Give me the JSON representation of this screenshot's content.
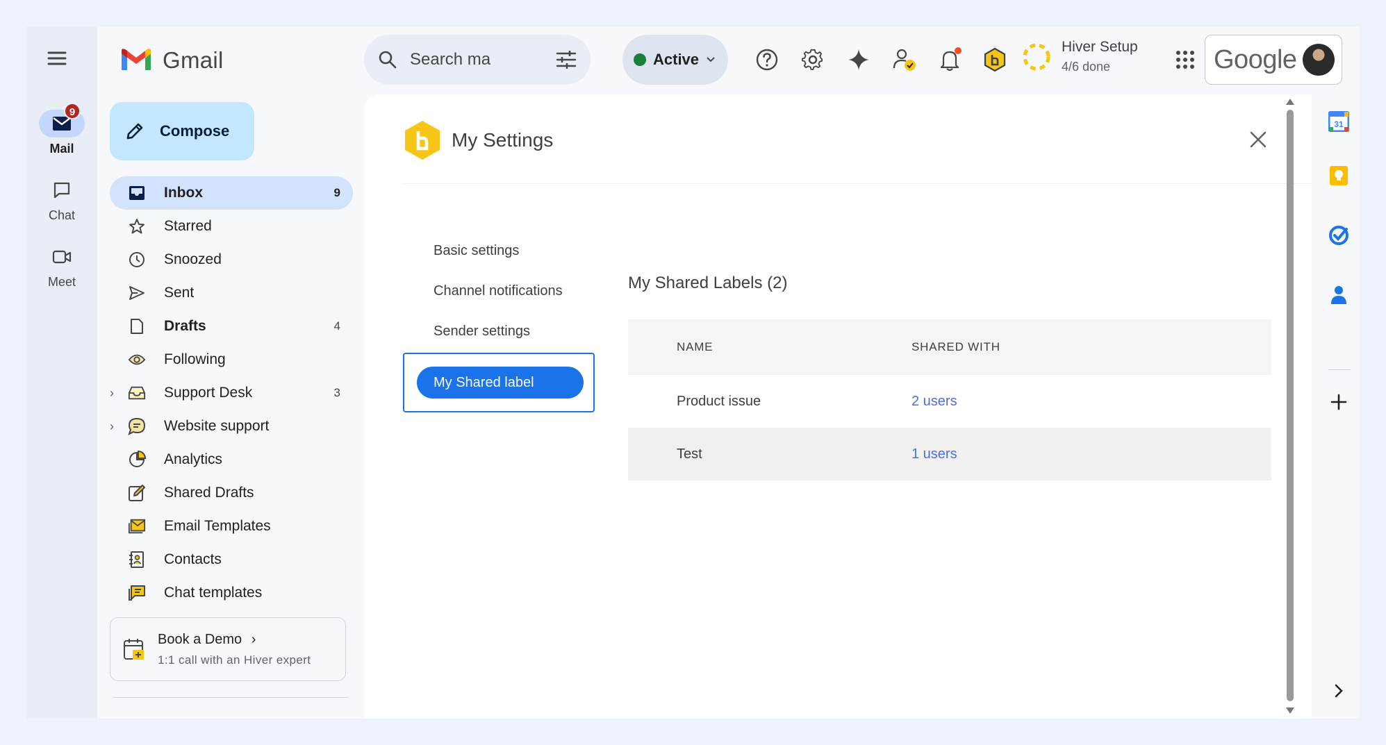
{
  "app": {
    "name": "Gmail"
  },
  "rail": {
    "items": [
      {
        "label": "Mail",
        "badge": "9",
        "icon": "mail-icon"
      },
      {
        "label": "Chat",
        "icon": "chat-icon"
      },
      {
        "label": "Meet",
        "icon": "video-icon"
      }
    ]
  },
  "search": {
    "placeholder": "Search ma"
  },
  "status": {
    "label": "Active",
    "color": "#188038"
  },
  "setup": {
    "title": "Hiver Setup",
    "progress": "4/6 done"
  },
  "google": {
    "wordmark": "Google"
  },
  "compose": {
    "label": "Compose"
  },
  "nav": {
    "items": [
      {
        "label": "Inbox",
        "count": "9",
        "icon": "inbox-icon"
      },
      {
        "label": "Starred",
        "count": "",
        "icon": "star-icon"
      },
      {
        "label": "Snoozed",
        "count": "",
        "icon": "clock-icon"
      },
      {
        "label": "Sent",
        "count": "",
        "icon": "send-icon"
      },
      {
        "label": "Drafts",
        "count": "4",
        "icon": "draft-icon"
      },
      {
        "label": "Following",
        "count": "",
        "icon": "eye-icon"
      },
      {
        "label": "Support Desk",
        "count": "3",
        "icon": "shared-inbox-icon"
      },
      {
        "label": "Website support",
        "count": "",
        "icon": "chat-bubble-icon"
      },
      {
        "label": "Analytics",
        "count": "",
        "icon": "pie-chart-icon"
      },
      {
        "label": "Shared Drafts",
        "count": "",
        "icon": "edit-icon"
      },
      {
        "label": "Email Templates",
        "count": "",
        "icon": "template-icon"
      },
      {
        "label": "Contacts",
        "count": "",
        "icon": "contacts-icon"
      },
      {
        "label": "Chat templates",
        "count": "",
        "icon": "chat-template-icon"
      }
    ]
  },
  "demo": {
    "title": "Book a Demo",
    "subtitle": "1:1 call with an Hiver expert"
  },
  "settings": {
    "title": "My Settings",
    "menu": [
      "Basic settings",
      "Channel notifications",
      "Sender settings"
    ],
    "selected": "My Shared label",
    "section_title": "My Shared Labels (2)",
    "columns": [
      "NAME",
      "SHARED WITH"
    ],
    "rows": [
      {
        "name": "Product issue",
        "shared": "2 users"
      },
      {
        "name": "Test",
        "shared": "1 users"
      }
    ]
  },
  "colors": {
    "accent": "#1a73e8",
    "hiver_yellow": "#f5c518",
    "badge_red": "#b3261e"
  }
}
